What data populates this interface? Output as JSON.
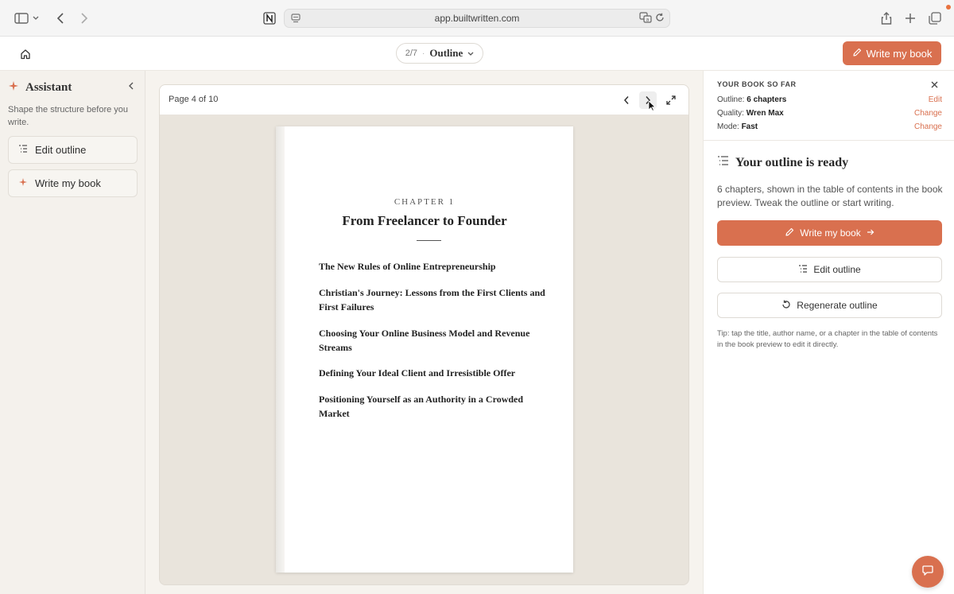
{
  "browser": {
    "url": "app.builtwritten.com",
    "icons": [
      "sidebar-icon",
      "chevron-down-icon",
      "back-icon",
      "forward-icon",
      "notion-icon",
      "site-settings-icon",
      "translate-icon",
      "reload-icon",
      "share-icon",
      "new-tab-icon",
      "tabs-icon"
    ]
  },
  "header": {
    "step_count": "2/7",
    "step_sep": "·",
    "step_label": "Outline",
    "write_button": "Write my book"
  },
  "sidebar": {
    "title": "Assistant",
    "subtitle": "Shape the structure before you write.",
    "buttons": [
      {
        "label": "Edit outline",
        "icon": "outline-list-icon"
      },
      {
        "label": "Write my book",
        "icon": "sparkle-icon"
      }
    ]
  },
  "preview": {
    "page_indicator": "Page 4 of 10",
    "chapter_label": "CHAPTER 1",
    "chapter_title": "From Freelancer to Founder",
    "toc": [
      "The New Rules of Online Entrepreneurship",
      "Christian's Journey: Lessons from the First Clients and First Failures",
      "Choosing Your Online Business Model and Revenue Streams",
      "Defining Your Ideal Client and Irresistible Offer",
      "Positioning Yourself as an Authority in a Crowded Market"
    ]
  },
  "panel": {
    "summary_title": "YOUR BOOK SO FAR",
    "rows": [
      {
        "key": "Outline:",
        "value": "6 chapters",
        "action": "Edit"
      },
      {
        "key": "Quality:",
        "value": "Wren Max",
        "action": "Change"
      },
      {
        "key": "Mode:",
        "value": "Fast",
        "action": "Change"
      }
    ],
    "heading": "Your outline is ready",
    "description": "6 chapters, shown in the table of contents in the book preview. Tweak the outline or start writing.",
    "primary_button": "Write my book",
    "edit_button": "Edit outline",
    "regenerate_button": "Regenerate outline",
    "tip": "Tip: tap the title, author name, or a chapter in the table of contents in the book preview to edit it directly."
  },
  "colors": {
    "accent": "#d9704f",
    "canvas": "#e9e4dc",
    "sidebar_bg": "#f4f1ec"
  }
}
